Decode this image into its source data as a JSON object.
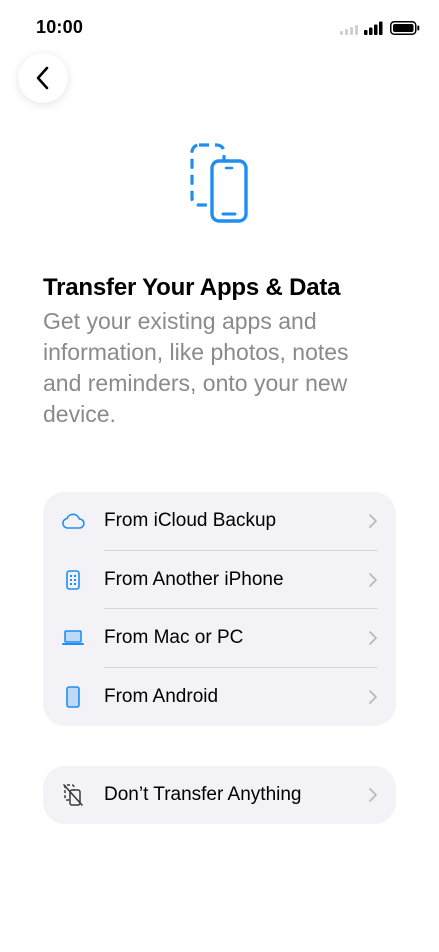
{
  "status_bar": {
    "time": "10:00"
  },
  "colors": {
    "accent": "#1f8ef1",
    "secondary_text": "#8a8a8e",
    "group_bg": "#f2f2f7"
  },
  "header": {
    "title": "Transfer Your Apps & Data",
    "subtitle": "Get your existing apps and information, like photos, notes and reminders, onto your new device."
  },
  "options": [
    {
      "label": "From iCloud Backup",
      "icon": "icloud-icon"
    },
    {
      "label": "From Another iPhone",
      "icon": "iphone-icon"
    },
    {
      "label": "From Mac or PC",
      "icon": "laptop-icon"
    },
    {
      "label": "From Android",
      "icon": "android-phone-icon"
    }
  ],
  "no_transfer": {
    "label": "Don’t Transfer Anything",
    "icon": "no-transfer-icon"
  }
}
